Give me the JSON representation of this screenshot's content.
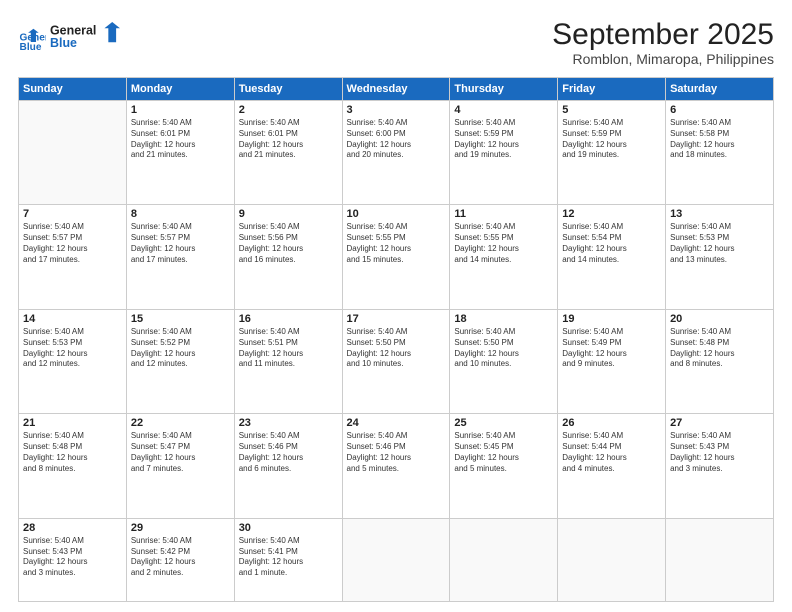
{
  "header": {
    "logo_line1": "General",
    "logo_line2": "Blue",
    "title": "September 2025",
    "subtitle": "Romblon, Mimaropa, Philippines"
  },
  "weekdays": [
    "Sunday",
    "Monday",
    "Tuesday",
    "Wednesday",
    "Thursday",
    "Friday",
    "Saturday"
  ],
  "weeks": [
    [
      {
        "day": "",
        "info": ""
      },
      {
        "day": "1",
        "info": "Sunrise: 5:40 AM\nSunset: 6:01 PM\nDaylight: 12 hours\nand 21 minutes."
      },
      {
        "day": "2",
        "info": "Sunrise: 5:40 AM\nSunset: 6:01 PM\nDaylight: 12 hours\nand 21 minutes."
      },
      {
        "day": "3",
        "info": "Sunrise: 5:40 AM\nSunset: 6:00 PM\nDaylight: 12 hours\nand 20 minutes."
      },
      {
        "day": "4",
        "info": "Sunrise: 5:40 AM\nSunset: 5:59 PM\nDaylight: 12 hours\nand 19 minutes."
      },
      {
        "day": "5",
        "info": "Sunrise: 5:40 AM\nSunset: 5:59 PM\nDaylight: 12 hours\nand 19 minutes."
      },
      {
        "day": "6",
        "info": "Sunrise: 5:40 AM\nSunset: 5:58 PM\nDaylight: 12 hours\nand 18 minutes."
      }
    ],
    [
      {
        "day": "7",
        "info": "Sunrise: 5:40 AM\nSunset: 5:57 PM\nDaylight: 12 hours\nand 17 minutes."
      },
      {
        "day": "8",
        "info": "Sunrise: 5:40 AM\nSunset: 5:57 PM\nDaylight: 12 hours\nand 17 minutes."
      },
      {
        "day": "9",
        "info": "Sunrise: 5:40 AM\nSunset: 5:56 PM\nDaylight: 12 hours\nand 16 minutes."
      },
      {
        "day": "10",
        "info": "Sunrise: 5:40 AM\nSunset: 5:55 PM\nDaylight: 12 hours\nand 15 minutes."
      },
      {
        "day": "11",
        "info": "Sunrise: 5:40 AM\nSunset: 5:55 PM\nDaylight: 12 hours\nand 14 minutes."
      },
      {
        "day": "12",
        "info": "Sunrise: 5:40 AM\nSunset: 5:54 PM\nDaylight: 12 hours\nand 14 minutes."
      },
      {
        "day": "13",
        "info": "Sunrise: 5:40 AM\nSunset: 5:53 PM\nDaylight: 12 hours\nand 13 minutes."
      }
    ],
    [
      {
        "day": "14",
        "info": "Sunrise: 5:40 AM\nSunset: 5:53 PM\nDaylight: 12 hours\nand 12 minutes."
      },
      {
        "day": "15",
        "info": "Sunrise: 5:40 AM\nSunset: 5:52 PM\nDaylight: 12 hours\nand 12 minutes."
      },
      {
        "day": "16",
        "info": "Sunrise: 5:40 AM\nSunset: 5:51 PM\nDaylight: 12 hours\nand 11 minutes."
      },
      {
        "day": "17",
        "info": "Sunrise: 5:40 AM\nSunset: 5:50 PM\nDaylight: 12 hours\nand 10 minutes."
      },
      {
        "day": "18",
        "info": "Sunrise: 5:40 AM\nSunset: 5:50 PM\nDaylight: 12 hours\nand 10 minutes."
      },
      {
        "day": "19",
        "info": "Sunrise: 5:40 AM\nSunset: 5:49 PM\nDaylight: 12 hours\nand 9 minutes."
      },
      {
        "day": "20",
        "info": "Sunrise: 5:40 AM\nSunset: 5:48 PM\nDaylight: 12 hours\nand 8 minutes."
      }
    ],
    [
      {
        "day": "21",
        "info": "Sunrise: 5:40 AM\nSunset: 5:48 PM\nDaylight: 12 hours\nand 8 minutes."
      },
      {
        "day": "22",
        "info": "Sunrise: 5:40 AM\nSunset: 5:47 PM\nDaylight: 12 hours\nand 7 minutes."
      },
      {
        "day": "23",
        "info": "Sunrise: 5:40 AM\nSunset: 5:46 PM\nDaylight: 12 hours\nand 6 minutes."
      },
      {
        "day": "24",
        "info": "Sunrise: 5:40 AM\nSunset: 5:46 PM\nDaylight: 12 hours\nand 5 minutes."
      },
      {
        "day": "25",
        "info": "Sunrise: 5:40 AM\nSunset: 5:45 PM\nDaylight: 12 hours\nand 5 minutes."
      },
      {
        "day": "26",
        "info": "Sunrise: 5:40 AM\nSunset: 5:44 PM\nDaylight: 12 hours\nand 4 minutes."
      },
      {
        "day": "27",
        "info": "Sunrise: 5:40 AM\nSunset: 5:43 PM\nDaylight: 12 hours\nand 3 minutes."
      }
    ],
    [
      {
        "day": "28",
        "info": "Sunrise: 5:40 AM\nSunset: 5:43 PM\nDaylight: 12 hours\nand 3 minutes."
      },
      {
        "day": "29",
        "info": "Sunrise: 5:40 AM\nSunset: 5:42 PM\nDaylight: 12 hours\nand 2 minutes."
      },
      {
        "day": "30",
        "info": "Sunrise: 5:40 AM\nSunset: 5:41 PM\nDaylight: 12 hours\nand 1 minute."
      },
      {
        "day": "",
        "info": ""
      },
      {
        "day": "",
        "info": ""
      },
      {
        "day": "",
        "info": ""
      },
      {
        "day": "",
        "info": ""
      }
    ]
  ]
}
